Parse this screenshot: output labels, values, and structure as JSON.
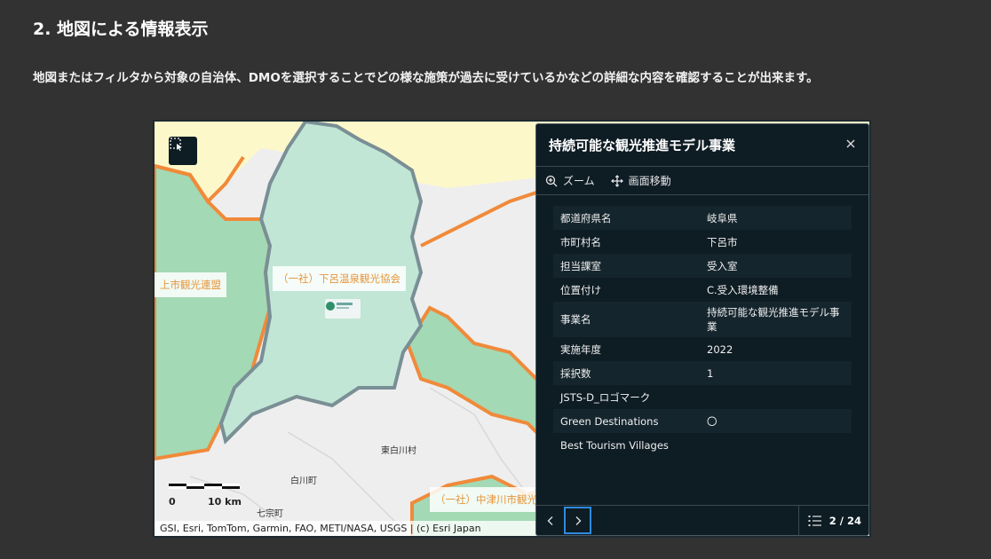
{
  "heading": "2. 地図による情報表示",
  "description": "地図またはフィルタから対象の自治体、DMOを選択することでどの様な施策が過去に受けているかなどの詳細な内容を確認することが出来ます。",
  "map": {
    "labels": {
      "dmo_left": "上市観光連盟",
      "dmo_gero": "（一社）下呂温泉観光協会",
      "dmo_nakatsugawa": "（一社）中津川市観光",
      "town_higashishirakawa": "東白川村",
      "town_shirakawa": "白川町",
      "town_hichisou": "七宗町"
    },
    "scale": {
      "zero": "0",
      "ten": "10 km"
    },
    "attribution": "GSI, Esri, TomTom, Garmin, FAO, METI/NASA, USGS | (c) Esri Japan",
    "colors": {
      "selected_fill": "#c1e6d6",
      "region_fill": "#a3d9b4",
      "border": "#f08a3a",
      "outline": "#7a8f95",
      "north_fill": "#fdf8c9"
    }
  },
  "popup": {
    "title": "持続可能な観光推進モデル事業",
    "actions": {
      "zoom": "ズーム",
      "pan": "画面移動"
    },
    "rows": [
      {
        "key": "都道府県名",
        "value": "岐阜県"
      },
      {
        "key": "市町村名",
        "value": "下呂市"
      },
      {
        "key": "担当課室",
        "value": "受入室"
      },
      {
        "key": "位置付け",
        "value": "C.受入環境整備"
      },
      {
        "key": "事業名",
        "value": "持続可能な観光推進モデル事業"
      },
      {
        "key": "実施年度",
        "value": "2022"
      },
      {
        "key": "採択数",
        "value": "1"
      },
      {
        "key": "JSTS-D_ロゴマーク",
        "value": ""
      },
      {
        "key": "Green Destinations",
        "value": "〇"
      },
      {
        "key": "Best Tourism Villages",
        "value": ""
      }
    ],
    "pager": "2 / 24"
  }
}
